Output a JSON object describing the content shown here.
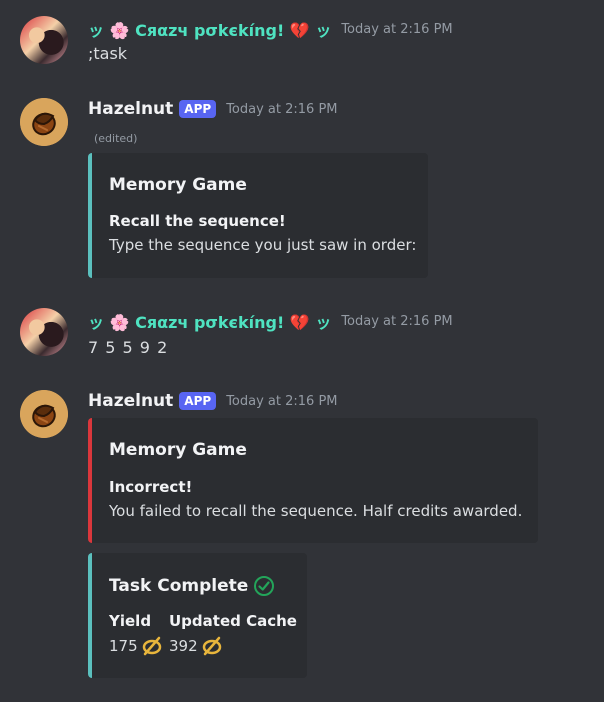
{
  "colors": {
    "background": "#313338",
    "username_user": "#4fe3c1",
    "app_tag": "#5865f2",
    "embed_teal": "#5bc0be",
    "embed_red": "#da373c",
    "check_green": "#23a55a",
    "coin_gold": "#e8b53c"
  },
  "messages": [
    {
      "author": {
        "prefix": "ッ ",
        "flower": "🌸",
        "name": " Cяαzч pσkєkíng! ",
        "heart": "💔",
        "suffix": " ッ"
      },
      "timestamp": "Today at 2:16 PM",
      "text": ";task"
    },
    {
      "author": {
        "name": "Hazelnut"
      },
      "tag": "APP",
      "timestamp": "Today at 2:16 PM",
      "edited": "(edited)",
      "embed": {
        "title": "Memory Game",
        "heading": "Recall the sequence!",
        "body": "Type the sequence you just saw in order:"
      }
    },
    {
      "author": {
        "prefix": "ッ ",
        "flower": "🌸",
        "name": " Cяαzч pσkєkíng! ",
        "heart": "💔",
        "suffix": " ッ"
      },
      "timestamp": "Today at 2:16 PM",
      "text": "7 5 5 9 2"
    },
    {
      "author": {
        "name": "Hazelnut"
      },
      "tag": "APP",
      "timestamp": "Today at 2:16 PM",
      "embed": {
        "title": "Memory Game",
        "heading": "Incorrect!",
        "body": "You failed to recall the sequence. Half credits awarded."
      },
      "embed2": {
        "title": "Task Complete",
        "check_icon": "check-circle-icon",
        "fields": [
          {
            "name": "Yield",
            "value": "175",
            "icon": "coin-icon"
          },
          {
            "name": "Updated Cache",
            "value": "392",
            "icon": "coin-icon"
          }
        ]
      }
    }
  ]
}
